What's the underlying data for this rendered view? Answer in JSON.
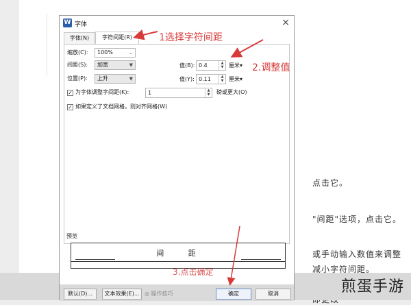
{
  "background_doc": {
    "lines": [
      "点击它。",
      "\"间距\"选项，点击它。",
      "或手动输入数值来调整",
      "减小字符间距。",
      "即更改"
    ]
  },
  "watermark": "煎蛋手游",
  "dialog": {
    "app_icon": "W",
    "title": "字体",
    "close": "×",
    "tabs": [
      {
        "label": "字体(N)"
      },
      {
        "label": "字符间距(R)"
      }
    ],
    "scale": {
      "label": "缩放(C):",
      "value": "100%"
    },
    "spacing": {
      "label": "间距(S):",
      "value": "加宽",
      "amount_label": "值(B):",
      "amount": "0.4",
      "unit": "厘米▾"
    },
    "position": {
      "label": "位置(P):",
      "value": "上升",
      "amount_label": "值(Y):",
      "amount": "0.11",
      "unit": "厘米▾"
    },
    "kerning": {
      "label": "为字体调整字间距(K):",
      "value": "1",
      "suffix": "磅或更大(O)"
    },
    "grid": {
      "label": "如果定义了文档网格，则对齐网格(W)"
    },
    "preview": {
      "label": "预览",
      "chars": [
        "间",
        "距"
      ]
    },
    "buttons": {
      "default": "默认(D)...",
      "text_effects": "文本效果(E)...",
      "tips": "操作技巧",
      "ok": "确定",
      "cancel": "取消"
    }
  },
  "annotations": {
    "step1": "1选择字符间距",
    "step2": "2.调整值",
    "step3": "3.点击确定"
  },
  "colors": {
    "annotation": "#d83a3a",
    "accent": "#2b5ea8"
  }
}
